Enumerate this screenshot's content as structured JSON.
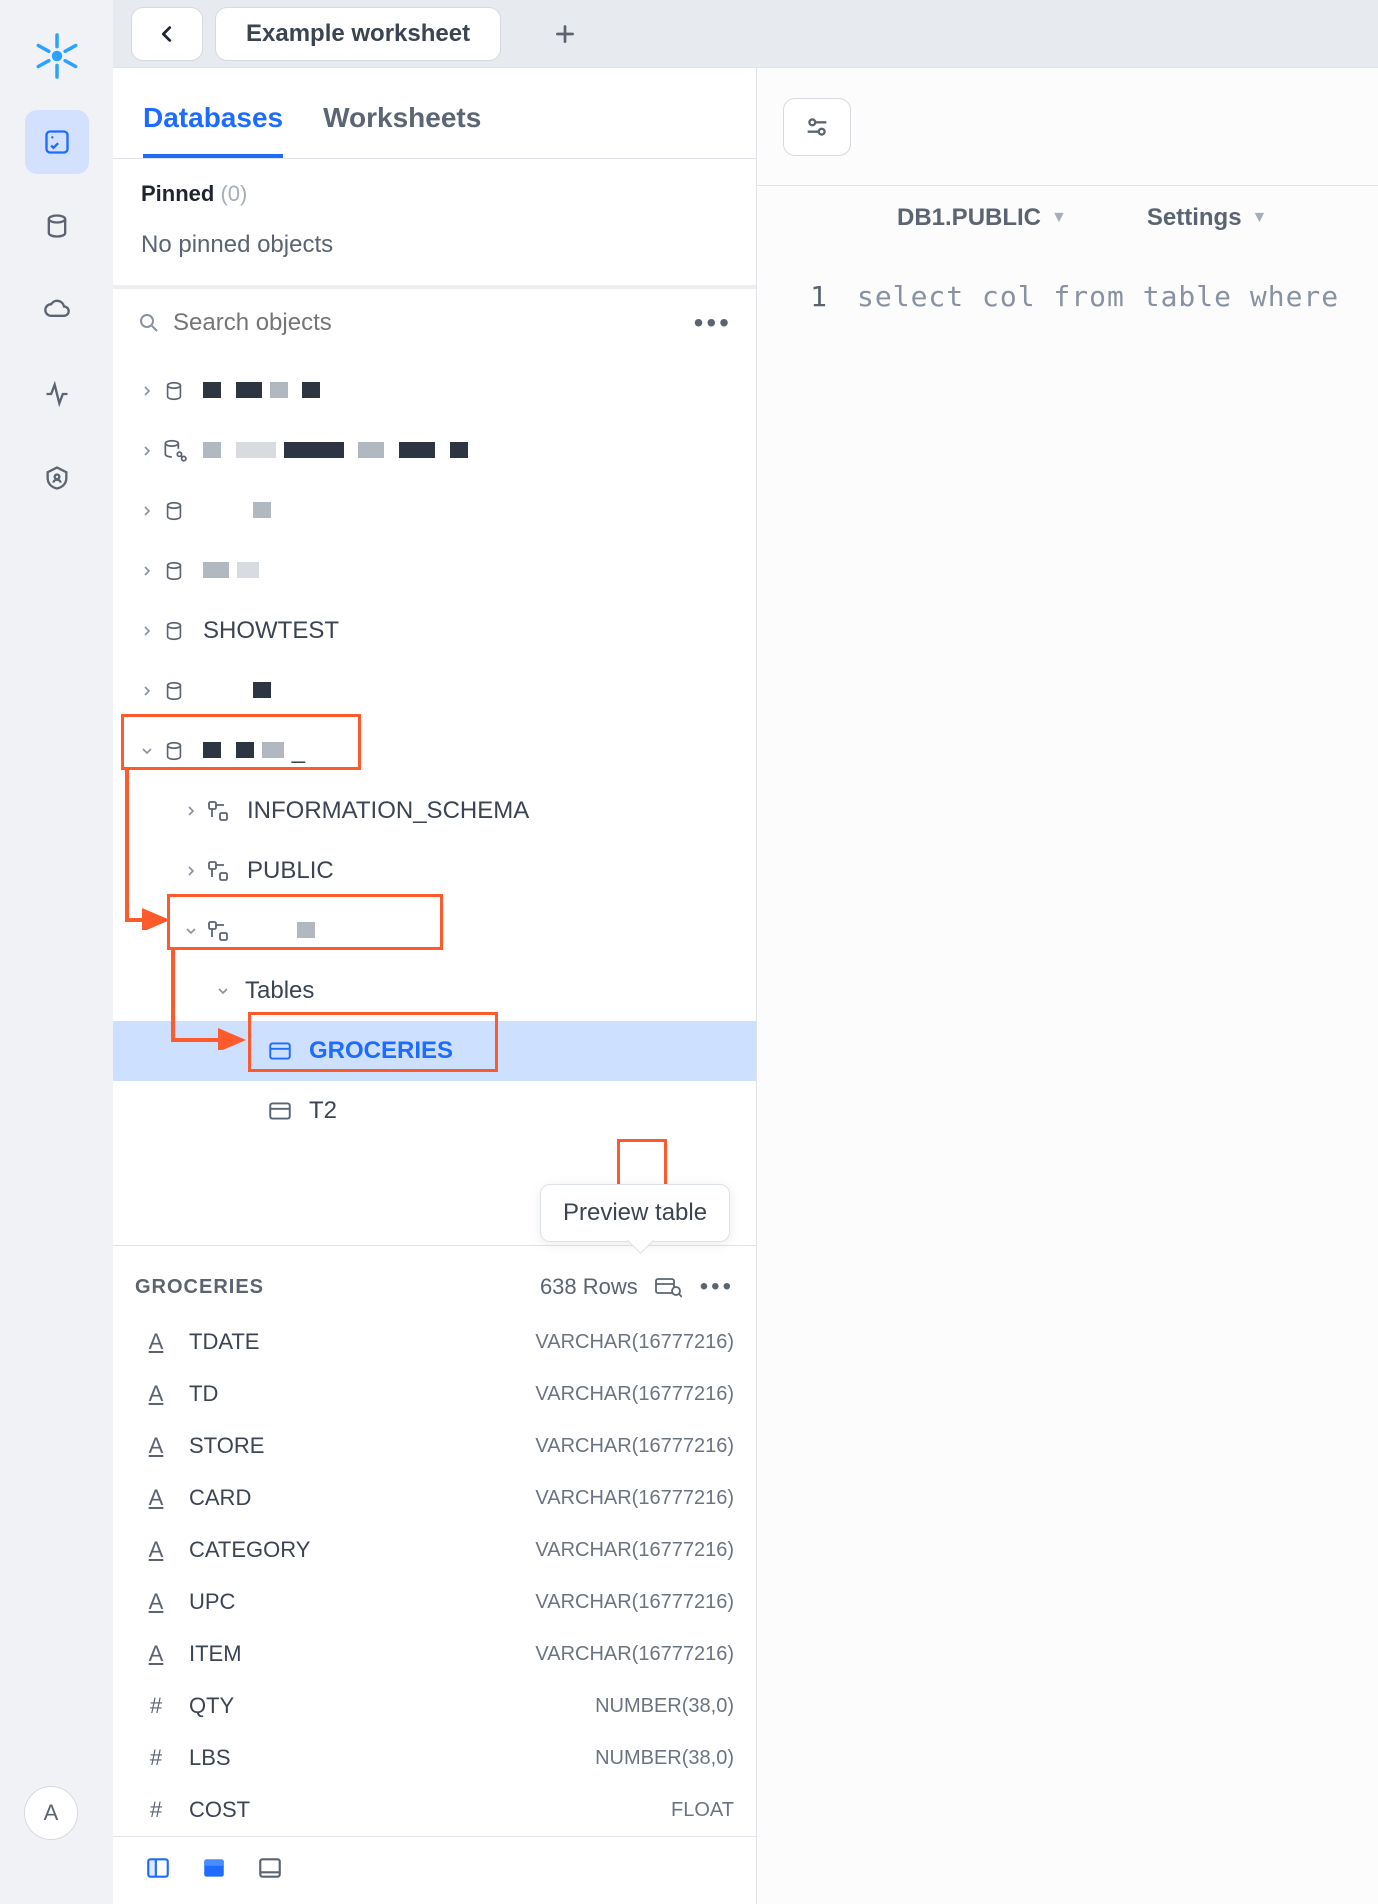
{
  "app": {
    "tab_title": "Example worksheet",
    "avatar_initial": "A"
  },
  "sidebar": {
    "tab_databases": "Databases",
    "tab_worksheets": "Worksheets",
    "pinned_label": "Pinned",
    "pinned_count": "(0)",
    "pinned_empty": "No pinned objects",
    "search_placeholder": "Search objects"
  },
  "tree": {
    "db_showtest": "SHOWTEST",
    "schema_info": "INFORMATION_SCHEMA",
    "schema_public": "PUBLIC",
    "group_tables": "Tables",
    "tbl_groceries": "GROCERIES",
    "tbl_t2": "T2",
    "redacted_db_label": "_"
  },
  "detail": {
    "table_name": "GROCERIES",
    "row_count": "638 Rows",
    "tooltip": "Preview table",
    "columns": [
      {
        "icon": "A",
        "num": false,
        "name": "TDATE",
        "type": "VARCHAR(16777216)"
      },
      {
        "icon": "A",
        "num": false,
        "name": "TD",
        "type": "VARCHAR(16777216)"
      },
      {
        "icon": "A",
        "num": false,
        "name": "STORE",
        "type": "VARCHAR(16777216)"
      },
      {
        "icon": "A",
        "num": false,
        "name": "CARD",
        "type": "VARCHAR(16777216)"
      },
      {
        "icon": "A",
        "num": false,
        "name": "CATEGORY",
        "type": "VARCHAR(16777216)"
      },
      {
        "icon": "A",
        "num": false,
        "name": "UPC",
        "type": "VARCHAR(16777216)"
      },
      {
        "icon": "A",
        "num": false,
        "name": "ITEM",
        "type": "VARCHAR(16777216)"
      },
      {
        "icon": "#",
        "num": true,
        "name": "QTY",
        "type": "NUMBER(38,0)"
      },
      {
        "icon": "#",
        "num": true,
        "name": "LBS",
        "type": "NUMBER(38,0)"
      },
      {
        "icon": "#",
        "num": true,
        "name": "COST",
        "type": "FLOAT"
      }
    ]
  },
  "editor": {
    "context_path": "DB1.PUBLIC",
    "settings_label": "Settings",
    "line_number": "1",
    "line_text": "select col from table where"
  }
}
